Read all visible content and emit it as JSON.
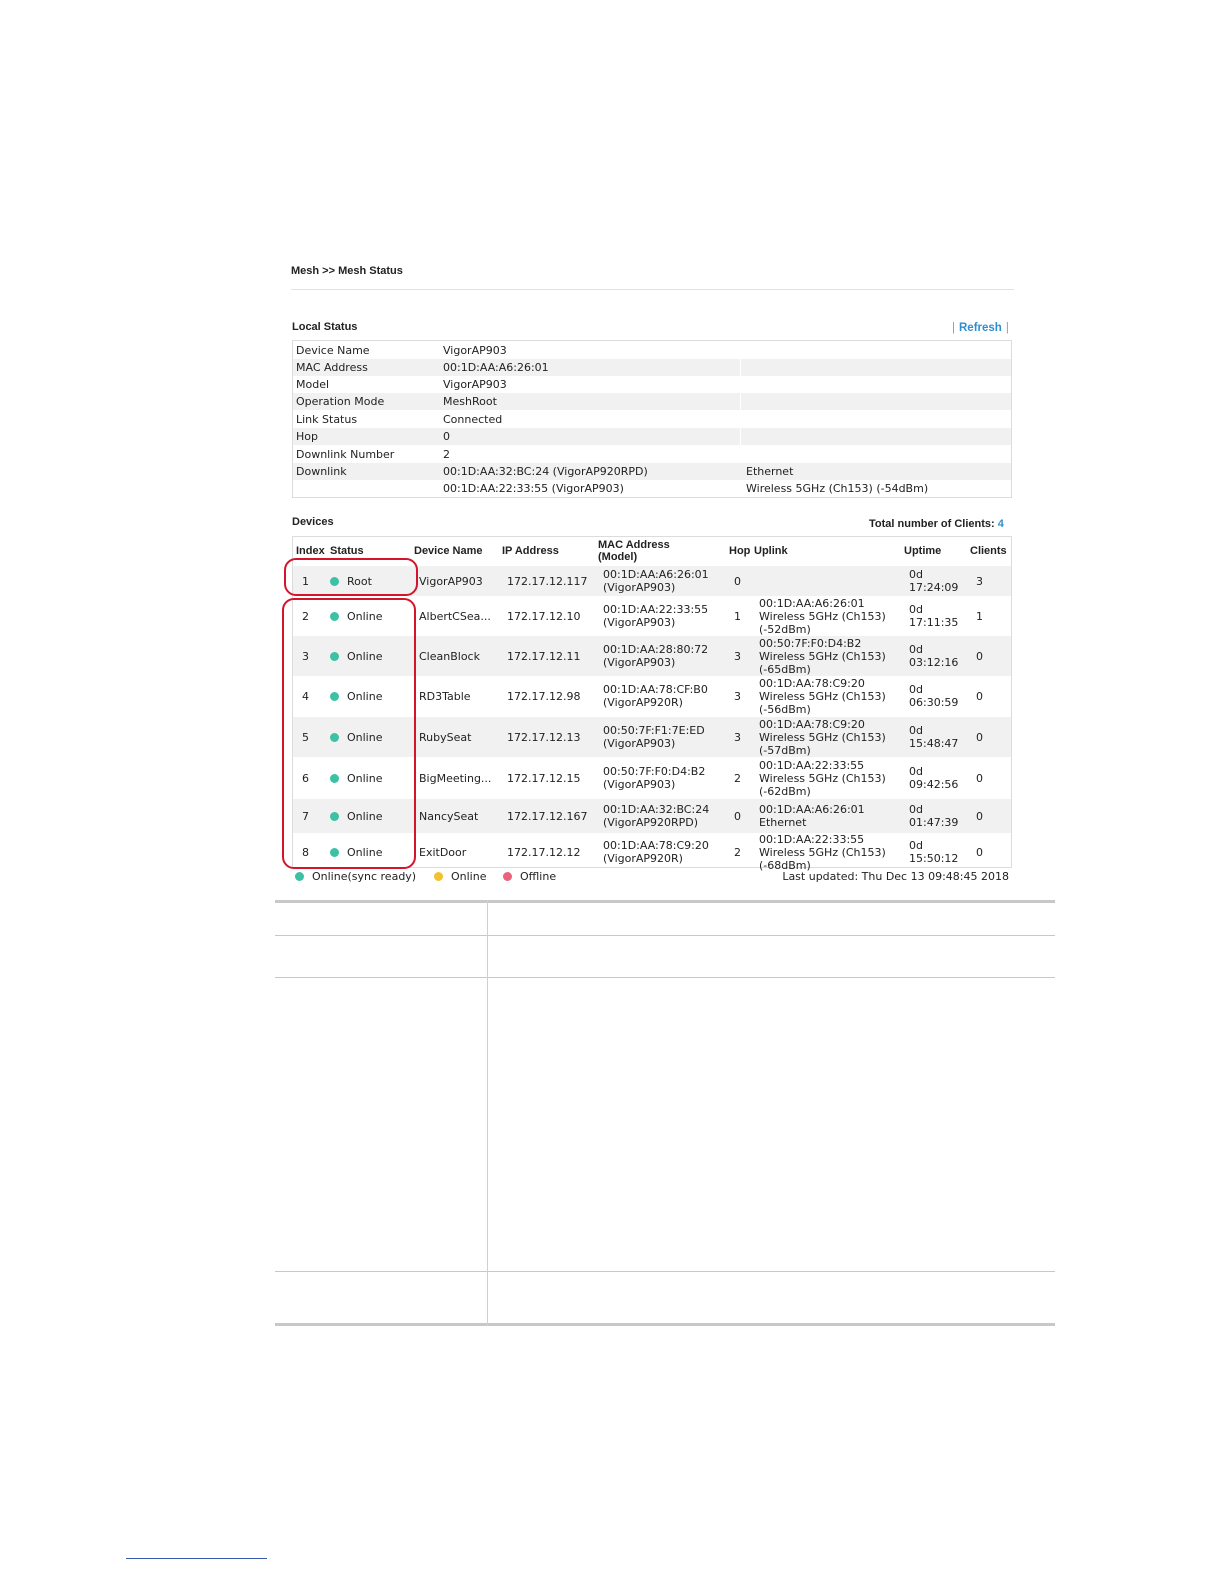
{
  "breadcrumb": "Mesh >> Mesh Status",
  "local_status": {
    "title": "Local Status",
    "refresh_label": "Refresh",
    "rows": [
      {
        "label": "Device Name",
        "value": "VigorAP903",
        "extra": ""
      },
      {
        "label": "MAC Address",
        "value": "00:1D:AA:A6:26:01",
        "extra": ""
      },
      {
        "label": "Model",
        "value": "VigorAP903",
        "extra": ""
      },
      {
        "label": "Operation Mode",
        "value": "MeshRoot",
        "extra": ""
      },
      {
        "label": "Link Status",
        "value": "Connected",
        "extra": ""
      },
      {
        "label": "Hop",
        "value": "0",
        "extra": ""
      },
      {
        "label": "Downlink Number",
        "value": "2",
        "extra": ""
      },
      {
        "label": "Downlink",
        "value": "00:1D:AA:32:BC:24 (VigorAP920RPD)",
        "extra": "Ethernet"
      },
      {
        "label": "",
        "value": "00:1D:AA:22:33:55 (VigorAP903)",
        "extra": "Wireless 5GHz (Ch153) (-54dBm)"
      }
    ]
  },
  "devices": {
    "title": "Devices",
    "total_label": "Total number of Clients:",
    "total_value": "4",
    "headers": {
      "index": "Index",
      "status": "Status",
      "device_name": "Device Name",
      "ip": "IP Address",
      "mac_line1": "MAC Address",
      "mac_line2": "(Model)",
      "hop": "Hop",
      "uplink": "Uplink",
      "uptime": "Uptime",
      "clients": "Clients"
    },
    "rows": [
      {
        "index": "1",
        "status": "Root",
        "name": "VigorAP903",
        "ip": "172.17.12.117",
        "mac": "00:1D:AA:A6:26:01",
        "model": "(VigorAP903)",
        "hop": "0",
        "uplink": [],
        "uptime_d": "0d",
        "uptime_t": "17:24:09",
        "clients": "3"
      },
      {
        "index": "2",
        "status": "Online",
        "name": "AlbertCSea...",
        "ip": "172.17.12.10",
        "mac": "00:1D:AA:22:33:55",
        "model": "(VigorAP903)",
        "hop": "1",
        "uplink": [
          "00:1D:AA:A6:26:01",
          "Wireless 5GHz (Ch153)",
          "(-52dBm)"
        ],
        "uptime_d": "0d",
        "uptime_t": "17:11:35",
        "clients": "1"
      },
      {
        "index": "3",
        "status": "Online",
        "name": "CleanBlock",
        "ip": "172.17.12.11",
        "mac": "00:1D:AA:28:80:72",
        "model": "(VigorAP903)",
        "hop": "3",
        "uplink": [
          "00:50:7F:F0:D4:B2",
          "Wireless 5GHz (Ch153)",
          "(-65dBm)"
        ],
        "uptime_d": "0d",
        "uptime_t": "03:12:16",
        "clients": "0"
      },
      {
        "index": "4",
        "status": "Online",
        "name": "RD3Table",
        "ip": "172.17.12.98",
        "mac": "00:1D:AA:78:CF:B0",
        "model": "(VigorAP920R)",
        "hop": "3",
        "uplink": [
          "00:1D:AA:78:C9:20",
          "Wireless 5GHz (Ch153)",
          "(-56dBm)"
        ],
        "uptime_d": "0d",
        "uptime_t": "06:30:59",
        "clients": "0"
      },
      {
        "index": "5",
        "status": "Online",
        "name": "RubySeat",
        "ip": "172.17.12.13",
        "mac": "00:50:7F:F1:7E:ED",
        "model": "(VigorAP903)",
        "hop": "3",
        "uplink": [
          "00:1D:AA:78:C9:20",
          "Wireless 5GHz (Ch153)",
          "(-57dBm)"
        ],
        "uptime_d": "0d",
        "uptime_t": "15:48:47",
        "clients": "0"
      },
      {
        "index": "6",
        "status": "Online",
        "name": "BigMeeting...",
        "ip": "172.17.12.15",
        "mac": "00:50:7F:F0:D4:B2",
        "model": "(VigorAP903)",
        "hop": "2",
        "uplink": [
          "00:1D:AA:22:33:55",
          "Wireless 5GHz (Ch153)",
          "(-62dBm)"
        ],
        "uptime_d": "0d",
        "uptime_t": "09:42:56",
        "clients": "0"
      },
      {
        "index": "7",
        "status": "Online",
        "name": "NancySeat",
        "ip": "172.17.12.167",
        "mac": "00:1D:AA:32:BC:24",
        "model": "(VigorAP920RPD)",
        "hop": "0",
        "uplink": [
          "00:1D:AA:A6:26:01",
          "Ethernet"
        ],
        "uptime_d": "0d",
        "uptime_t": "01:47:39",
        "clients": "0"
      },
      {
        "index": "8",
        "status": "Online",
        "name": "ExitDoor",
        "ip": "172.17.12.12",
        "mac": "00:1D:AA:78:C9:20",
        "model": "(VigorAP920R)",
        "hop": "2",
        "uplink": [
          "00:1D:AA:22:33:55",
          "Wireless 5GHz (Ch153)",
          "(-68dBm)"
        ],
        "uptime_d": "0d",
        "uptime_t": "15:50:12",
        "clients": "0"
      }
    ]
  },
  "legend": {
    "items": [
      {
        "label": "Online(sync ready)",
        "color": "#3cc1a4"
      },
      {
        "label": "Online",
        "color": "#f2c12e"
      },
      {
        "label": "Offline",
        "color": "#e9637a"
      }
    ],
    "last_updated": "Last updated: Thu Dec 13 09:48:45 2018"
  },
  "colors": {
    "accent": "#2f8fcf",
    "highlight": "#d3142b",
    "online_sync": "#3cc1a4"
  }
}
